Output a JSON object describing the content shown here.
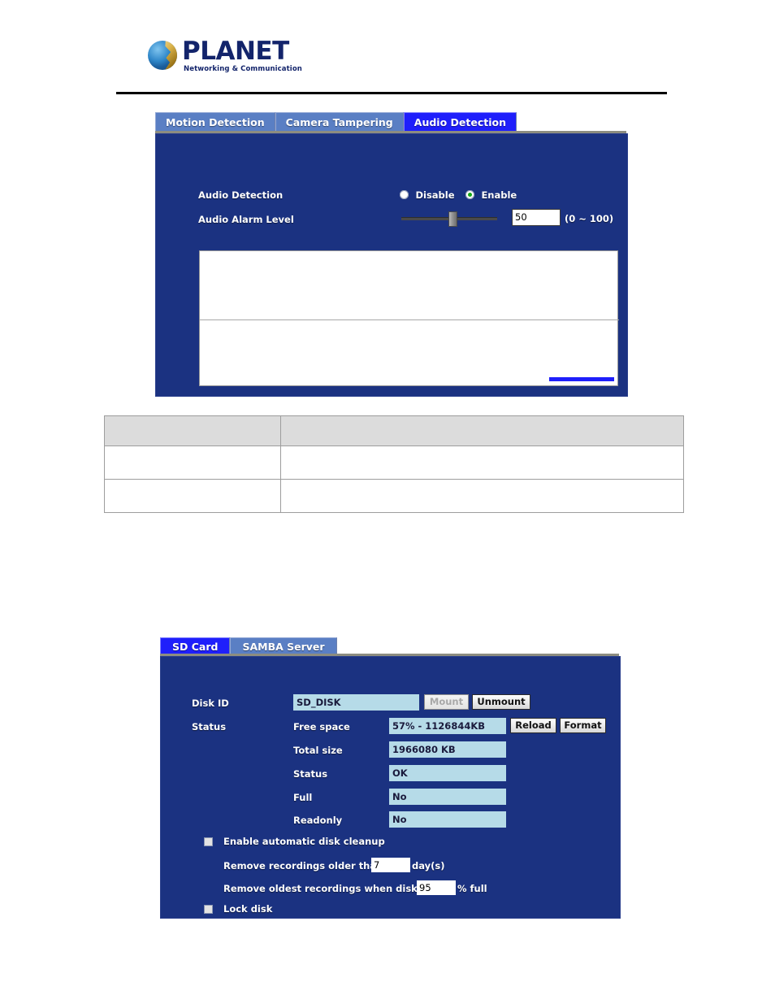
{
  "brand": {
    "name": "PLANET",
    "tagline": "Networking & Communication",
    "logo_icon": "planet-globe-icon",
    "brand_color": "#13246b"
  },
  "colors": {
    "panel_bg": "#1b3281",
    "tab_active": "#1f1ffb",
    "tab_inactive": "#5a7fc4",
    "field_cyan": "#b6dbe8",
    "radio_on": "#14a814"
  },
  "audio_panel": {
    "tabs": [
      {
        "label": "Motion Detection",
        "active": false
      },
      {
        "label": "Camera Tampering",
        "active": false
      },
      {
        "label": "Audio Detection",
        "active": true
      }
    ],
    "fields": {
      "audio_detection_label": "Audio Detection",
      "disable_label": "Disable",
      "enable_label": "Enable",
      "audio_detection_value": "Enable",
      "alarm_level_label": "Audio Alarm Level",
      "alarm_level_value": "50",
      "alarm_level_range": "(0 ~ 100)",
      "alarm_level_min": 0,
      "alarm_level_max": 100
    }
  },
  "doc_table": {
    "header_cells": [
      "",
      ""
    ],
    "rows": [
      [
        "",
        ""
      ],
      [
        "",
        ""
      ]
    ]
  },
  "storage_panel": {
    "tabs": [
      {
        "label": "SD Card",
        "active": true
      },
      {
        "label": "SAMBA Server",
        "active": false
      }
    ],
    "disk_id_label": "Disk ID",
    "disk_id_value": "SD_DISK",
    "mount_button": "Mount",
    "unmount_button": "Unmount",
    "status_label": "Status",
    "reload_button": "Reload",
    "format_button": "Format",
    "status_rows": [
      {
        "label": "Free space",
        "value": "57% - 1126844KB"
      },
      {
        "label": "Total size",
        "value": "1966080 KB"
      },
      {
        "label": "Status",
        "value": "OK"
      },
      {
        "label": "Full",
        "value": "No"
      },
      {
        "label": "Readonly",
        "value": "No"
      }
    ],
    "cleanup_checkbox_label": "Enable automatic disk cleanup",
    "cleanup_checked": false,
    "remove_older_label": "Remove recordings older than:",
    "remove_older_value": "7",
    "remove_older_unit": "day(s)",
    "remove_oldest_label": "Remove oldest recordings when disk is:",
    "remove_oldest_value": "95",
    "remove_oldest_unit": "% full",
    "lock_disk_label": "Lock disk",
    "lock_disk_checked": false
  }
}
